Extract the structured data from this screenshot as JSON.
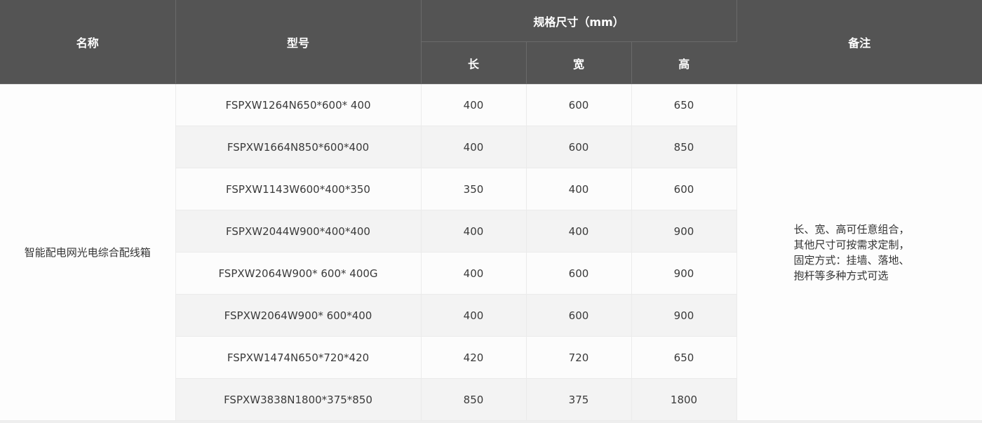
{
  "header": {
    "name": "名称",
    "model": "型号",
    "spec": "规格尺寸（mm）",
    "length": "长",
    "width": "宽",
    "height": "高",
    "remark": "备注"
  },
  "product_name": "智能配电网光电综合配线箱",
  "rows": [
    {
      "model": "FSPXW1264N650*600* 400",
      "length": "400",
      "width": "600",
      "height": "650"
    },
    {
      "model": "FSPXW1664N850*600*400",
      "length": "400",
      "width": "600",
      "height": "850"
    },
    {
      "model": "FSPXW1143W600*400*350",
      "length": "350",
      "width": "400",
      "height": "600"
    },
    {
      "model": "FSPXW2044W900*400*400",
      "length": "400",
      "width": "400",
      "height": "900"
    },
    {
      "model": "FSPXW2064W900* 600* 400G",
      "length": "400",
      "width": "600",
      "height": "900"
    },
    {
      "model": "FSPXW2064W900* 600*400",
      "length": "400",
      "width": "600",
      "height": "900"
    },
    {
      "model": "FSPXW1474N650*720*420",
      "length": "420",
      "width": "720",
      "height": "650"
    },
    {
      "model": "FSPXW3838N1800*375*850",
      "length": "850",
      "width": "375",
      "height": "1800"
    }
  ],
  "remark_lines": [
    "长、宽、高可任意组合，",
    "其他尺寸可按需求定制，",
    "固定方式：挂墙、落地、",
    "抱杆等多种方式可选"
  ]
}
